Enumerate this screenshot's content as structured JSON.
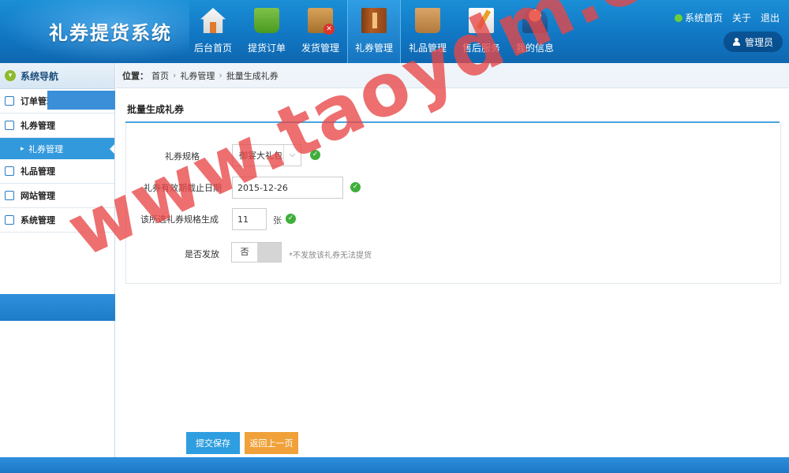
{
  "app": {
    "title": "礼券提货系统"
  },
  "nav": [
    {
      "label": "后台首页",
      "icon": "home-icon"
    },
    {
      "label": "提货订单",
      "icon": "cart-icon"
    },
    {
      "label": "发货管理",
      "icon": "box-icon"
    },
    {
      "label": "礼券管理",
      "icon": "book-icon",
      "active": true
    },
    {
      "label": "礼品管理",
      "icon": "gift-bag-icon"
    },
    {
      "label": "售后服务",
      "icon": "note-icon"
    },
    {
      "label": "我的信息",
      "icon": "user-icon"
    }
  ],
  "top_links": {
    "home": "系统首页",
    "about": "关于",
    "logout": "退出",
    "admin": "管理员"
  },
  "sidebar": {
    "header": "系统导航",
    "items": [
      {
        "label": "订单管理"
      },
      {
        "label": "礼券管理"
      },
      {
        "label": "礼券管理",
        "sub": true,
        "active": true
      },
      {
        "label": "礼品管理"
      },
      {
        "label": "网站管理"
      },
      {
        "label": "系统管理"
      }
    ]
  },
  "breadcrumb": {
    "prefix": "位置：",
    "items": [
      "首页",
      "礼券管理",
      "批量生成礼券"
    ]
  },
  "section_title": "批量生成礼券",
  "form": {
    "spec_label": "礼券规格",
    "spec_value": "御宴大礼包",
    "expiry_label": "礼券有效期截止日期",
    "expiry_value": "2015-12-26",
    "count_label": "该所选礼券规格生成",
    "count_value": "11",
    "count_unit": "张",
    "issue_label": "是否发放",
    "issue_value": "否",
    "issue_hint": "*不发放该礼券无法提货"
  },
  "buttons": {
    "submit": "提交保存",
    "back": "返回上一页"
  },
  "watermark": "www.taoydm.com",
  "colors": {
    "header": "#1177c4",
    "accent": "#2f9ee0",
    "back_button": "#f0a13a",
    "check": "#3fae3a",
    "watermark": "#e84646"
  }
}
